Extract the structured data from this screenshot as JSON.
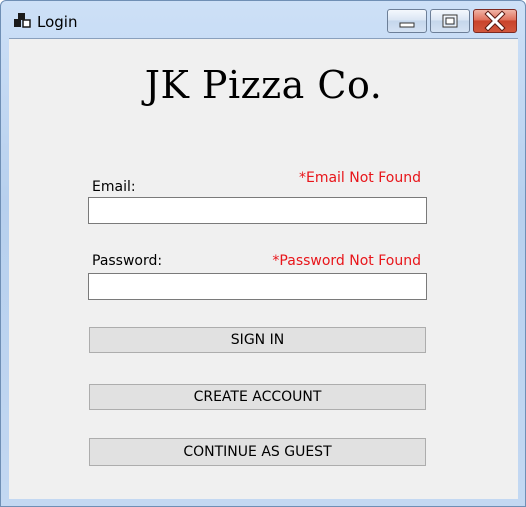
{
  "window": {
    "title": "Login",
    "controls": [
      "minimize-icon",
      "maximize-icon",
      "close-icon"
    ],
    "close_color": "#c9432b"
  },
  "brand": {
    "text": "JK Pizza Co."
  },
  "email": {
    "label": "Email:",
    "error": "*Email Not Found",
    "value": "",
    "placeholder": ""
  },
  "password": {
    "label": "Password:",
    "error": "*Password Not Found",
    "value": "",
    "placeholder": ""
  },
  "buttons": {
    "sign_in": "SIGN IN",
    "create_account": "CREATE ACCOUNT",
    "guest": "CONTINUE AS GUEST"
  },
  "colors": {
    "error": "#e8151a",
    "form_background": "#f0f0f0",
    "button_background": "#e1e1e1"
  }
}
